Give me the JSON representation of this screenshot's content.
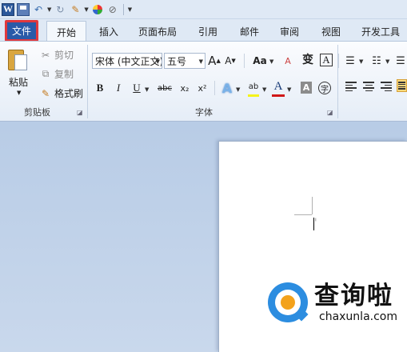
{
  "qat": {
    "icons": [
      "word-logo-icon",
      "save-icon",
      "undo-icon",
      "redo-icon",
      "format-painter-icon",
      "color-icon",
      "clear-format-icon",
      "customize-qat-icon"
    ],
    "word_letter": "W"
  },
  "tabs": [
    {
      "label": "文件",
      "active": false,
      "highlighted": true
    },
    {
      "label": "开始",
      "active": true
    },
    {
      "label": "插入"
    },
    {
      "label": "页面布局"
    },
    {
      "label": "引用"
    },
    {
      "label": "邮件"
    },
    {
      "label": "审阅"
    },
    {
      "label": "视图"
    },
    {
      "label": "开发工具"
    }
  ],
  "clipboard": {
    "paste_label": "粘贴",
    "cut_label": "剪切",
    "copy_label": "复制",
    "format_painter_label": "格式刷",
    "group_label": "剪贴板"
  },
  "font": {
    "font_name": "宋体 (中文正文)",
    "font_size": "五号",
    "grow_symbol": "A",
    "shrink_symbol": "A",
    "case_label": "Aa",
    "clear_symbol": "A",
    "phonetic_symbol": "变",
    "border_symbol": "A",
    "bold": "B",
    "italic": "I",
    "underline": "U",
    "strike": "abc",
    "subscript": "x₂",
    "superscript": "x²",
    "text_effect": "A",
    "highlight": "ab",
    "font_color": "A",
    "shading": "A",
    "enclose": "字",
    "group_label": "字体"
  },
  "colors": {
    "file_tab": "#2a5aa8",
    "file_highlight_border": "#e0393e",
    "highlight_yellow": "#f5f31a",
    "font_red": "#d01818",
    "watermark_blue": "#2c8de0",
    "watermark_orange": "#f3a21c"
  },
  "watermark": {
    "cn": "查询啦",
    "en": "chaxunla.com"
  }
}
